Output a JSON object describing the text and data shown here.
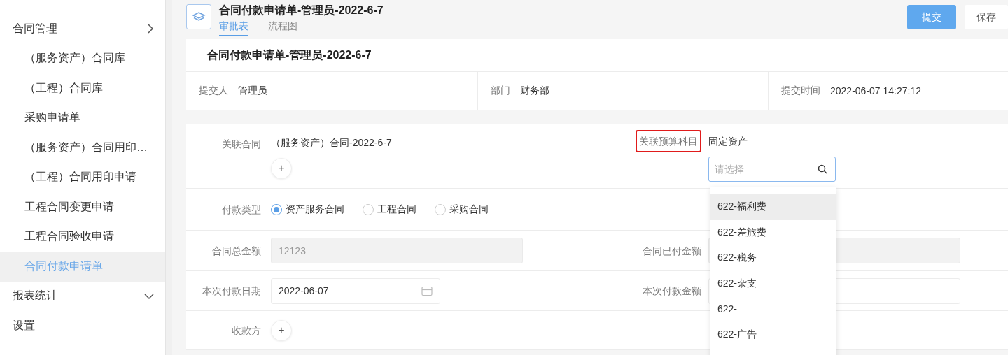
{
  "sidebar": {
    "items": [
      {
        "label": "合同管理",
        "expanded": true,
        "children": [
          {
            "label": "（服务资产）合同库",
            "selected": false
          },
          {
            "label": "（工程）合同库",
            "selected": false
          },
          {
            "label": "采购申请单",
            "selected": false
          },
          {
            "label": "（服务资产）合同用印…",
            "selected": false
          },
          {
            "label": "（工程）合同用印申请",
            "selected": false
          },
          {
            "label": "工程合同变更申请",
            "selected": false
          },
          {
            "label": "工程合同验收申请",
            "selected": false
          },
          {
            "label": "合同付款申请单",
            "selected": true
          }
        ]
      },
      {
        "label": "报表统计",
        "expanded": false
      },
      {
        "label": "设置"
      }
    ]
  },
  "header": {
    "title": "合同付款申请单-管理员-2022-6-7",
    "tabs": [
      {
        "label": "审批表",
        "selected": true
      },
      {
        "label": "流程图",
        "selected": false
      }
    ],
    "buttons": [
      {
        "label": "提交",
        "kind": "primary"
      },
      {
        "label": "保存",
        "kind": "default"
      }
    ]
  },
  "form_title": "合同付款申请单-管理员-2022-6-7",
  "info": [
    {
      "label": "提交人",
      "value": "管理员"
    },
    {
      "label": "部门",
      "value": "财务部"
    },
    {
      "label": "提交时间",
      "value": "2022-06-07 14:27:12"
    }
  ],
  "contract": {
    "label": "关联合同",
    "value": "（服务资产）合同-2022-6-7",
    "add": "+",
    "budget_label": "关联预算科目",
    "budget_outlined": true,
    "budget_value": "固定资产",
    "select_placeholder": "请选择"
  },
  "payment_type": {
    "label": "付款类型",
    "options": [
      {
        "label": "资产服务合同",
        "selected": true
      },
      {
        "label": "工程合同",
        "selected": false
      },
      {
        "label": "采购合同",
        "selected": false
      }
    ]
  },
  "amount": {
    "label": "合同总金额",
    "value": "12123",
    "paid_label": "合同已付金额"
  },
  "date": {
    "label": "本次付款日期",
    "value": "2022-06-07",
    "pay_label": "本次付款金额"
  },
  "payee": {
    "label": "收款方",
    "add": "+"
  },
  "dropdown": {
    "items": [
      {
        "label": "622-福利费",
        "selected": true
      },
      {
        "label": "622-差旅费",
        "selected": false
      },
      {
        "label": "622-税务",
        "selected": false
      },
      {
        "label": "622-杂支",
        "selected": false
      },
      {
        "label": "622-",
        "selected": false
      },
      {
        "label": "622-广告",
        "selected": false
      }
    ]
  }
}
